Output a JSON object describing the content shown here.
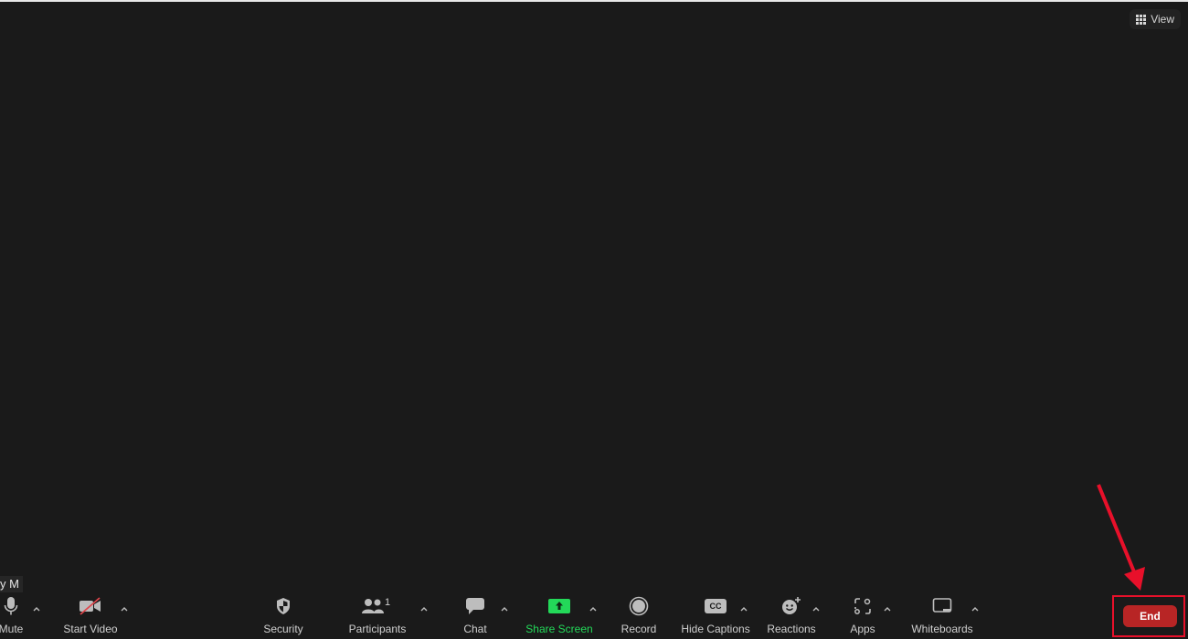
{
  "meeting": {
    "view_label": "View",
    "name_tag": "y M"
  },
  "toolbar": {
    "mute_label": "Mute",
    "start_video_label": "Start Video",
    "security_label": "Security",
    "participants_label": "Participants",
    "participants_count": "1",
    "chat_label": "Chat",
    "share_screen_label": "Share Screen",
    "record_label": "Record",
    "hide_captions_label": "Hide Captions",
    "cc_badge": "CC",
    "reactions_label": "Reactions",
    "apps_label": "Apps",
    "whiteboards_label": "Whiteboards",
    "end_label": "End"
  },
  "colors": {
    "background": "#1a1a1a",
    "share_green": "#23d959",
    "end_red": "#b82525",
    "annotation_red": "#e8102a"
  }
}
